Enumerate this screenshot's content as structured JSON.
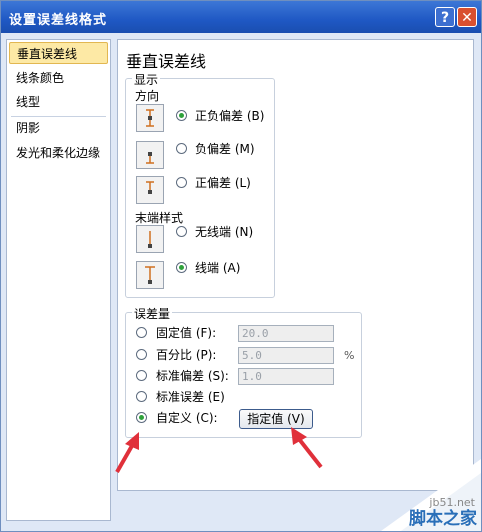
{
  "window": {
    "title": "设置误差线格式",
    "help": "?",
    "close": "✕"
  },
  "sidebar": {
    "items": [
      {
        "label": "垂直误差线",
        "selected": true
      },
      {
        "label": "线条颜色"
      },
      {
        "label": "线型"
      },
      {
        "label": "阴影"
      },
      {
        "label": "发光和柔化边缘"
      }
    ]
  },
  "panel": {
    "title": "垂直误差线",
    "display": {
      "legend": "显示",
      "direction_label": "方向",
      "directions": [
        {
          "label": "正负偏差 (B)",
          "icon": "plus-minus-errorbar-icon",
          "selected": true
        },
        {
          "label": "负偏差 (M)",
          "icon": "minus-errorbar-icon",
          "selected": false
        },
        {
          "label": "正偏差 (L)",
          "icon": "plus-errorbar-icon",
          "selected": false
        }
      ],
      "endstyle_label": "末端样式",
      "endstyles": [
        {
          "label": "无线端 (N)",
          "icon": "no-cap-icon",
          "selected": false
        },
        {
          "label": "线端 (A)",
          "icon": "cap-icon",
          "selected": true
        }
      ]
    },
    "error_amount": {
      "legend": "误差量",
      "options": [
        {
          "label": "固定值 (F):",
          "value": "20.0",
          "selected": false
        },
        {
          "label": "百分比 (P):",
          "value": "5.0",
          "unit": "%",
          "selected": false
        },
        {
          "label": "标准偏差 (S):",
          "value": "1.0",
          "selected": false
        },
        {
          "label": "标准误差 (E)",
          "selected": false
        },
        {
          "label": "自定义 (C):",
          "selected": true
        }
      ],
      "specify_button": "指定值 (V)"
    }
  },
  "watermark": {
    "site": "jb51.net",
    "name": "脚本之家"
  },
  "colors": {
    "titlebar": "#1f58c4",
    "selection": "#fde9a5",
    "arrow": "#e0303a",
    "radio_on": "#2ea13b"
  }
}
